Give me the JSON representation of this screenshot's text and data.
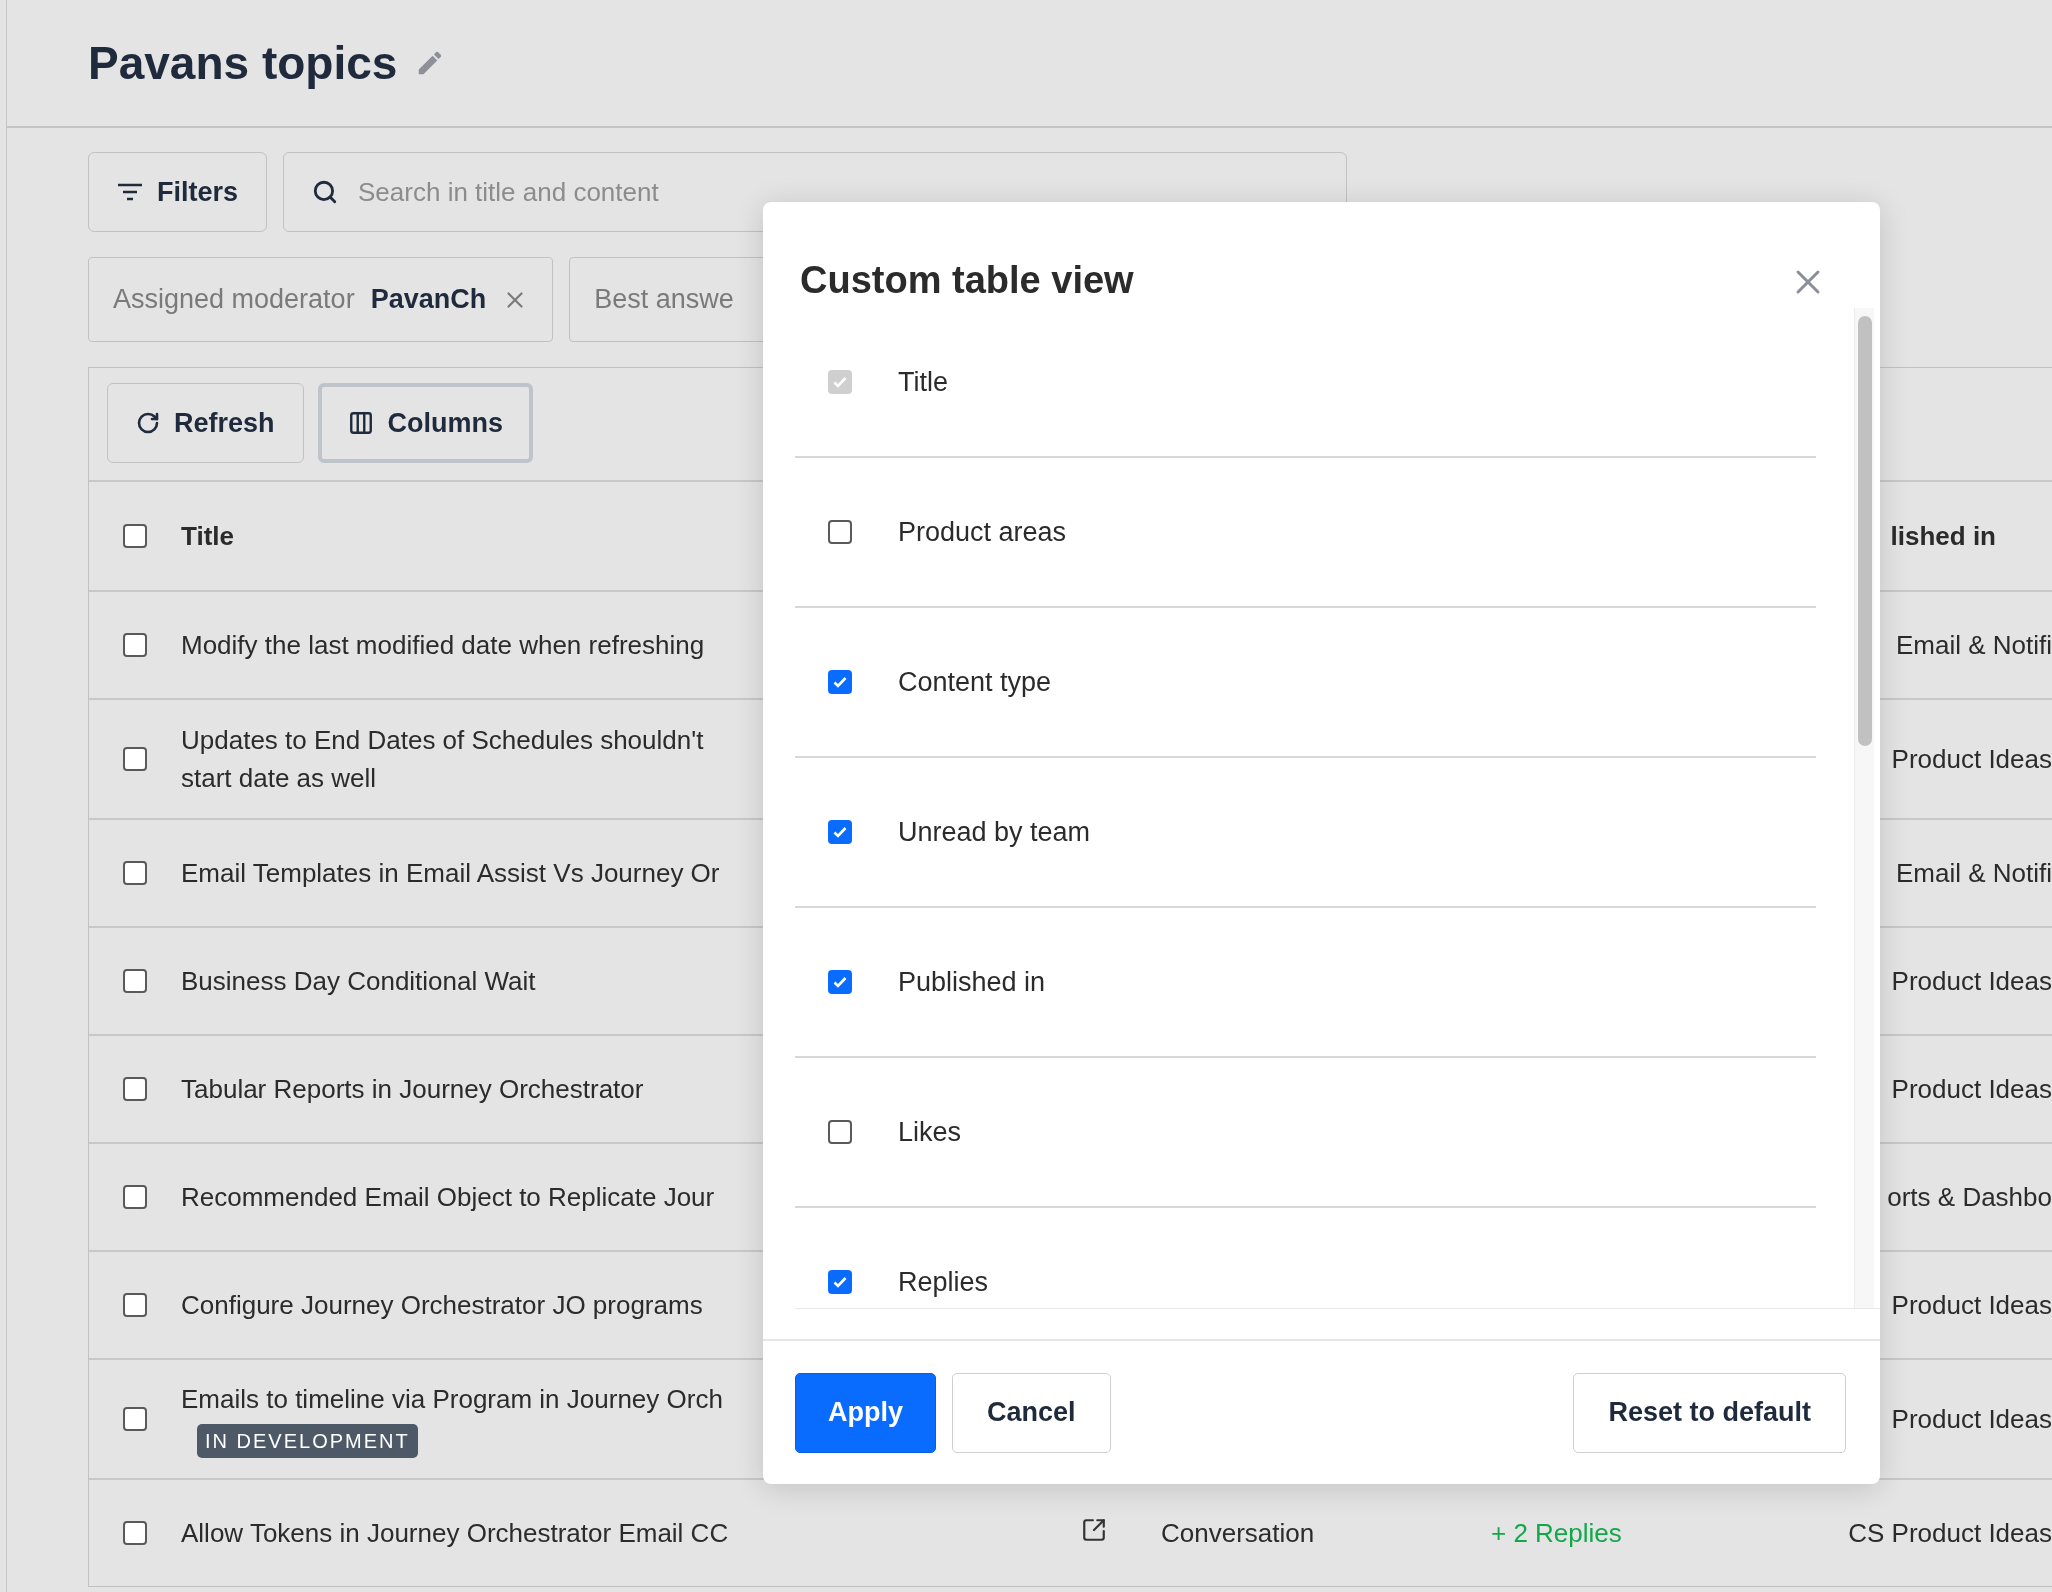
{
  "page": {
    "title": "Pavans topics"
  },
  "filters_button": "Filters",
  "search": {
    "placeholder": "Search in title and content"
  },
  "filter_chips": [
    {
      "label": "Assigned moderator",
      "value": "PavanCh",
      "removable": true
    },
    {
      "label": "Best answe",
      "removable": false
    }
  ],
  "table_actions": [
    {
      "kind": "refresh",
      "label": "Refresh",
      "focused": false
    },
    {
      "kind": "columns",
      "label": "Columns",
      "focused": true
    }
  ],
  "table": {
    "all_selected": false,
    "columns": [
      "Title",
      "lished in"
    ],
    "rows": [
      {
        "selected": false,
        "title_lines": [
          "Modify the last modified date when refreshing"
        ],
        "published_in": "Email & Notifi"
      },
      {
        "selected": false,
        "title_lines": [
          "Updates to End Dates of Schedules shouldn't",
          "start date as well"
        ],
        "published_in": "Product Ideas"
      },
      {
        "selected": false,
        "title_lines": [
          "Email Templates in Email Assist Vs Journey Or"
        ],
        "published_in": "Email & Notifi"
      },
      {
        "selected": false,
        "title_lines": [
          "Business Day Conditional Wait"
        ],
        "published_in": "Product Ideas"
      },
      {
        "selected": false,
        "title_lines": [
          "Tabular Reports in Journey Orchestrator"
        ],
        "published_in": "Product Ideas"
      },
      {
        "selected": false,
        "title_lines": [
          "Recommended Email Object to Replicate Jour"
        ],
        "published_in": "orts & Dashbo"
      },
      {
        "selected": false,
        "title_lines": [
          "Configure Journey Orchestrator JO programs"
        ],
        "published_in": "Product Ideas"
      },
      {
        "selected": false,
        "title_lines": [
          "Emails to timeline via Program in Journey Orch"
        ],
        "badge": "IN DEVELOPMENT",
        "published_in": "Product Ideas"
      },
      {
        "selected": false,
        "title_lines": [
          "Allow Tokens in Journey Orchestrator Email CC"
        ],
        "content_type": "Conversation",
        "replies": "+ 2 Replies",
        "published_in": "CS Product Ideas"
      }
    ]
  },
  "modal": {
    "title": "Custom table view",
    "options": [
      {
        "label": "Title",
        "checked": true,
        "disabled": true
      },
      {
        "label": "Product areas",
        "checked": false,
        "disabled": false
      },
      {
        "label": "Content type",
        "checked": true,
        "disabled": false
      },
      {
        "label": "Unread by team",
        "checked": true,
        "disabled": false
      },
      {
        "label": "Published in",
        "checked": true,
        "disabled": false
      },
      {
        "label": "Likes",
        "checked": false,
        "disabled": false
      },
      {
        "label": "Replies",
        "checked": true,
        "disabled": false
      }
    ],
    "apply": "Apply",
    "cancel": "Cancel",
    "reset": "Reset to default"
  }
}
